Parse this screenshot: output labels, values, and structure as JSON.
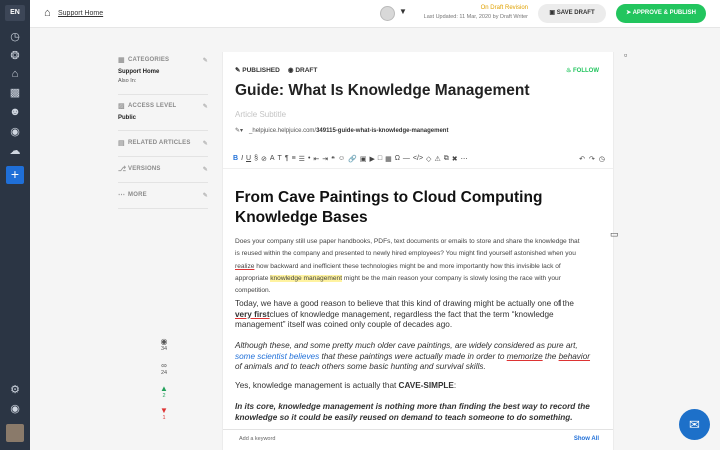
{
  "rail": {
    "lang": "EN",
    "icons": [
      "clock-icon",
      "network-icon",
      "home-icon",
      "chart-icon",
      "users-icon",
      "globe-icon",
      "cloud-upload-icon"
    ],
    "plus": "+"
  },
  "topbar": {
    "breadcrumb": "Support Home",
    "revision_label": "On Draft Revision",
    "last_updated": "Last Updated: 11 Mar, 2020 by Draft Writer",
    "save_label": "SAVE DRAFT",
    "publish_label": "APPROVE & PUBLISH"
  },
  "meta": {
    "categories": {
      "head": "CATEGORIES",
      "value": "Support Home",
      "sub": "Also In:"
    },
    "access": {
      "head": "ACCESS LEVEL",
      "value": "Public"
    },
    "related": {
      "head": "RELATED ARTICLES"
    },
    "versions": {
      "head": "VERSIONS"
    },
    "more": {
      "head": "MORE"
    }
  },
  "stats": {
    "views": "34",
    "readers": "24",
    "likes": "2",
    "dislikes": "1"
  },
  "editor": {
    "published": "PUBLISHED",
    "draft": "DRAFT",
    "follow": "FOLLOW",
    "title": "Guide: What Is Knowledge Management",
    "subtitle_placeholder": "Article Subtitle",
    "url_prefix": "_helpjuice.helpjuice.com/",
    "url_slug": "349115-guide-what-is-knowledge-management",
    "heading": "From Cave Paintings to Cloud Computing Knowledge Bases",
    "p1_a": "Does your company still use paper handbooks, PDFs, text documents or emails to store and share the knowledge that is reused within the company and presented to newly hired employees? You might find yourself astonished when you ",
    "p1_realize": "realize",
    "p1_b": " how backward and inefficient these technologies might be and more importantly how this invisible lack of appropriate ",
    "p1_hl": "knowledge management",
    "p1_c": " might be the main reason your company is slowly losing the race with your competition.",
    "p2_a": "Today, we have a good reason to believe that this kind of drawing might be actually one of the ",
    "p2_bold": "very first",
    "p2_b": "clues of knowledge management, regardless the fact that the term “knowledge management” itself was coined only couple of decades ago.",
    "p3_a": "Although these, and some pretty much older cave paintings, are widely considered as pure art, ",
    "p3_link": "some scientist believes",
    "p3_b": " that these paintings were actually made in order to ",
    "p3_memorize": "memorize",
    "p3_c": " the ",
    "p3_behavior": "behavior",
    "p3_d": " of animals and to teach others some basic hunting and survival skills.",
    "p4_a": "Yes, knowledge management is actually that ",
    "p4_bold": "CAVE-SIMPLE",
    "p4_b": ":",
    "p5": "In its core, knowledge management is nothing more than finding the best way to record the knowledge so it could be easily reused on demand to teach someone to do something.",
    "keyword_placeholder": "Add a keyword",
    "show_all": "Show All"
  }
}
